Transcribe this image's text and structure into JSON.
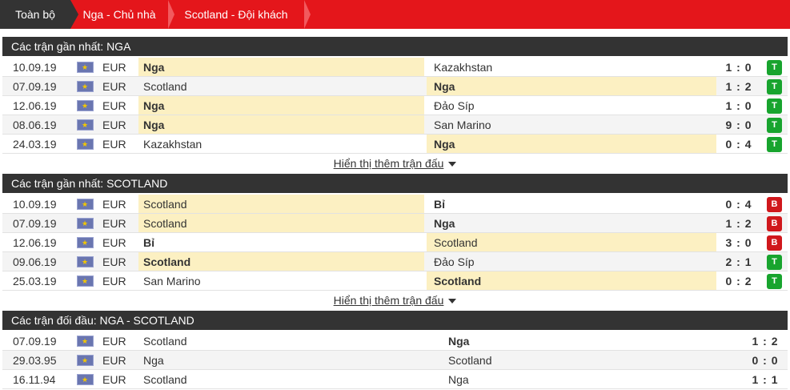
{
  "tabs": [
    "Toàn bộ",
    "Nga - Chủ nhà",
    "Scotland - Đội khách"
  ],
  "more_label": "Hiển thị thêm trận đấu",
  "colors": {
    "accent": "#e4161b",
    "header": "#333333",
    "highlight": "#fcf0c2",
    "win": "#18a42e",
    "loss": "#d0181c"
  },
  "sections": [
    {
      "title": "Các trận gần nhất: NGA",
      "rows": [
        {
          "date": "10.09.19",
          "comp": "EUR",
          "home": "Nga",
          "away": "Kazakhstan",
          "score": "1 : 0",
          "result": "T",
          "hl": "home"
        },
        {
          "date": "07.09.19",
          "comp": "EUR",
          "home": "Scotland",
          "away": "Nga",
          "score": "1 : 2",
          "result": "T",
          "hl": "away"
        },
        {
          "date": "12.06.19",
          "comp": "EUR",
          "home": "Nga",
          "away": "Đảo Síp",
          "score": "1 : 0",
          "result": "T",
          "hl": "home"
        },
        {
          "date": "08.06.19",
          "comp": "EUR",
          "home": "Nga",
          "away": "San Marino",
          "score": "9 : 0",
          "result": "T",
          "hl": "home"
        },
        {
          "date": "24.03.19",
          "comp": "EUR",
          "home": "Kazakhstan",
          "away": "Nga",
          "score": "0 : 4",
          "result": "T",
          "hl": "away"
        }
      ]
    },
    {
      "title": "Các trận gần nhất: SCOTLAND",
      "rows": [
        {
          "date": "10.09.19",
          "comp": "EUR",
          "home": "Scotland",
          "away": "Bỉ",
          "score": "0 : 4",
          "result": "B",
          "hl": "home"
        },
        {
          "date": "07.09.19",
          "comp": "EUR",
          "home": "Scotland",
          "away": "Nga",
          "score": "1 : 2",
          "result": "B",
          "hl": "home"
        },
        {
          "date": "12.06.19",
          "comp": "EUR",
          "home": "Bỉ",
          "away": "Scotland",
          "score": "3 : 0",
          "result": "B",
          "hl": "away"
        },
        {
          "date": "09.06.19",
          "comp": "EUR",
          "home": "Scotland",
          "away": "Đảo Síp",
          "score": "2 : 1",
          "result": "T",
          "hl": "home"
        },
        {
          "date": "25.03.19",
          "comp": "EUR",
          "home": "San Marino",
          "away": "Scotland",
          "score": "0 : 2",
          "result": "T",
          "hl": "away"
        }
      ]
    },
    {
      "title": "Các trận đối đầu: NGA - SCOTLAND",
      "rows": [
        {
          "date": "07.09.19",
          "comp": "EUR",
          "home": "Scotland",
          "away": "Nga",
          "score": "1 : 2"
        },
        {
          "date": "29.03.95",
          "comp": "EUR",
          "home": "Nga",
          "away": "Scotland",
          "score": "0 : 0"
        },
        {
          "date": "16.11.94",
          "comp": "EUR",
          "home": "Scotland",
          "away": "Nga",
          "score": "1 : 1"
        }
      ]
    }
  ]
}
